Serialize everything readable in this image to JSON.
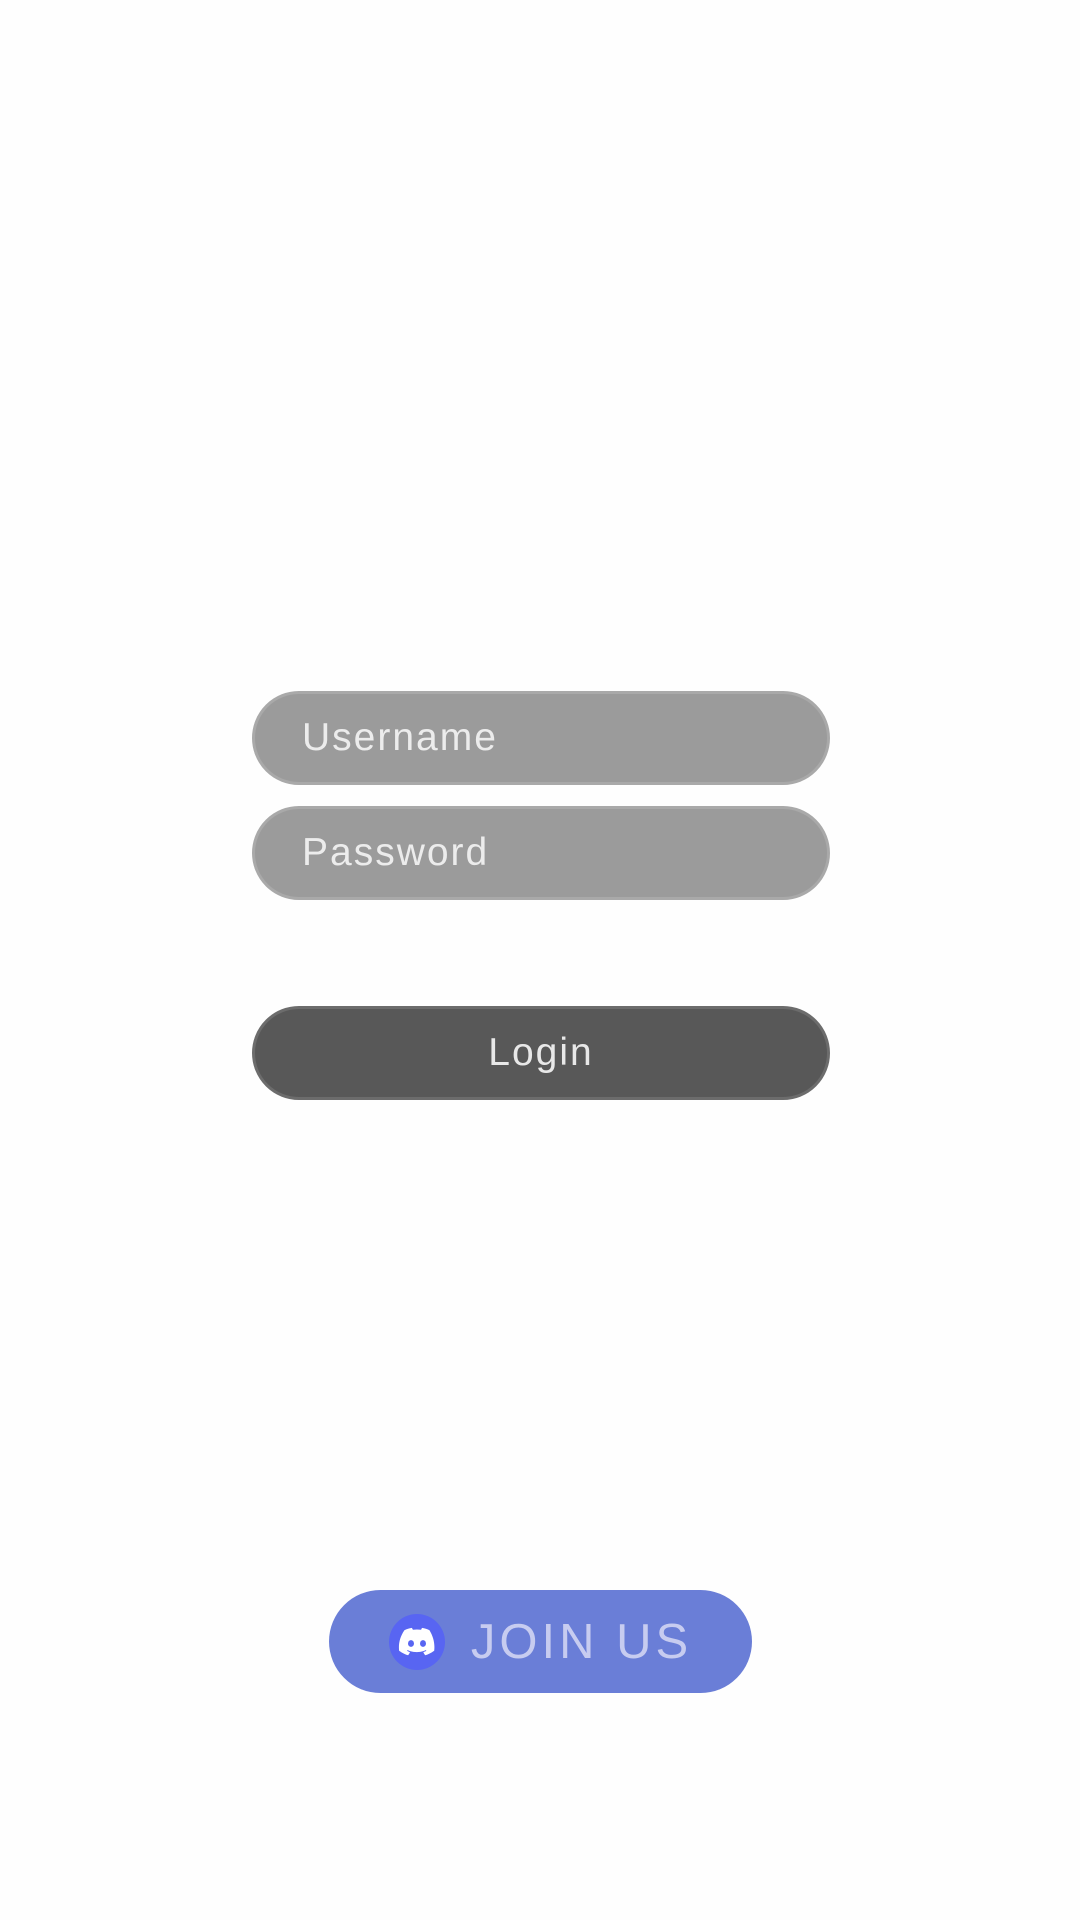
{
  "login_form": {
    "username_placeholder": "Username",
    "password_placeholder": "Password",
    "login_label": "Login"
  },
  "join": {
    "label": "JOIN US",
    "icon": "discord-icon"
  },
  "colors": {
    "background": "#fefefe",
    "input_fill": "#9b9b9b",
    "login_fill": "#585858",
    "join_fill": "#6a7ed7",
    "discord_blurple": "#5865f2"
  }
}
